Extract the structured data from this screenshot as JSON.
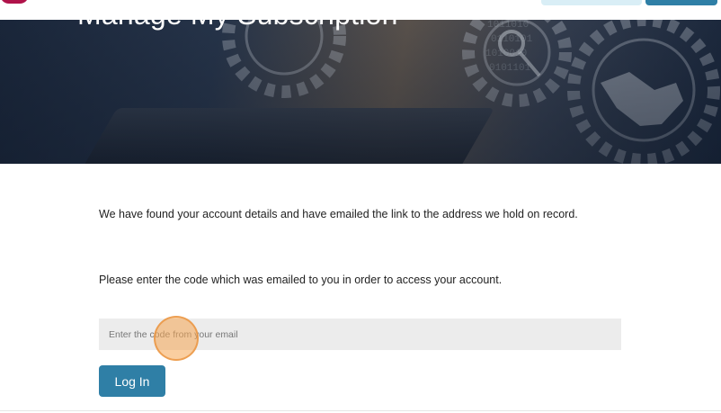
{
  "hero": {
    "title": "Manage My Subscription"
  },
  "content": {
    "found_message": "We have found your account details and have emailed the link to the address we hold on record.",
    "enter_message": "Please enter the code which was emailed to you in order to access your account."
  },
  "form": {
    "code_placeholder": "Enter the code from your email",
    "code_value": "",
    "login_label": "Log In"
  },
  "colors": {
    "primary": "#2f7fa6",
    "brand": "#b0134a",
    "input_bg": "#ececec",
    "click_marker": "#f6a552"
  },
  "icons": {
    "hero_graphic": [
      "gear-icon",
      "magnifier-icon",
      "handshake-icon",
      "laptop-icon"
    ]
  }
}
